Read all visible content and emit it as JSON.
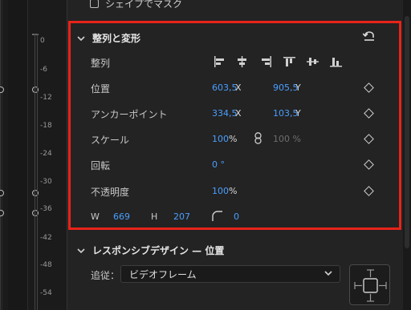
{
  "shape_mask": {
    "label": "シェイプでマスク"
  },
  "vu_meter": {
    "labels": [
      "0",
      "-6",
      "-12",
      "-18",
      "-24",
      "-30",
      "-36",
      "-42",
      "-48",
      "-54"
    ]
  },
  "align_transform": {
    "title": "整列と変形",
    "align_label": "整列",
    "position": {
      "label": "位置",
      "x": "603,5",
      "x_unit": "X",
      "y": "905,5",
      "y_unit": "Y"
    },
    "anchor": {
      "label": "アンカーポイント",
      "x": "334,5",
      "x_unit": "X",
      "y": "103,5",
      "y_unit": "Y"
    },
    "scale": {
      "label": "スケール",
      "value": "100",
      "unit": "%",
      "linked_value": "100 %"
    },
    "rotation": {
      "label": "回転",
      "value": "0 °"
    },
    "opacity": {
      "label": "不透明度",
      "value": "100",
      "unit": "%"
    },
    "size": {
      "w_label": "W",
      "w": "669",
      "h_label": "H",
      "h": "207",
      "radius": "0"
    }
  },
  "responsive": {
    "title": "レスポンシブデザイン — 位置",
    "follow_label": "追従：",
    "follow_value": "ビデオフレーム"
  },
  "colors": {
    "accent": "#4a9eff",
    "highlight": "#e8231a"
  }
}
